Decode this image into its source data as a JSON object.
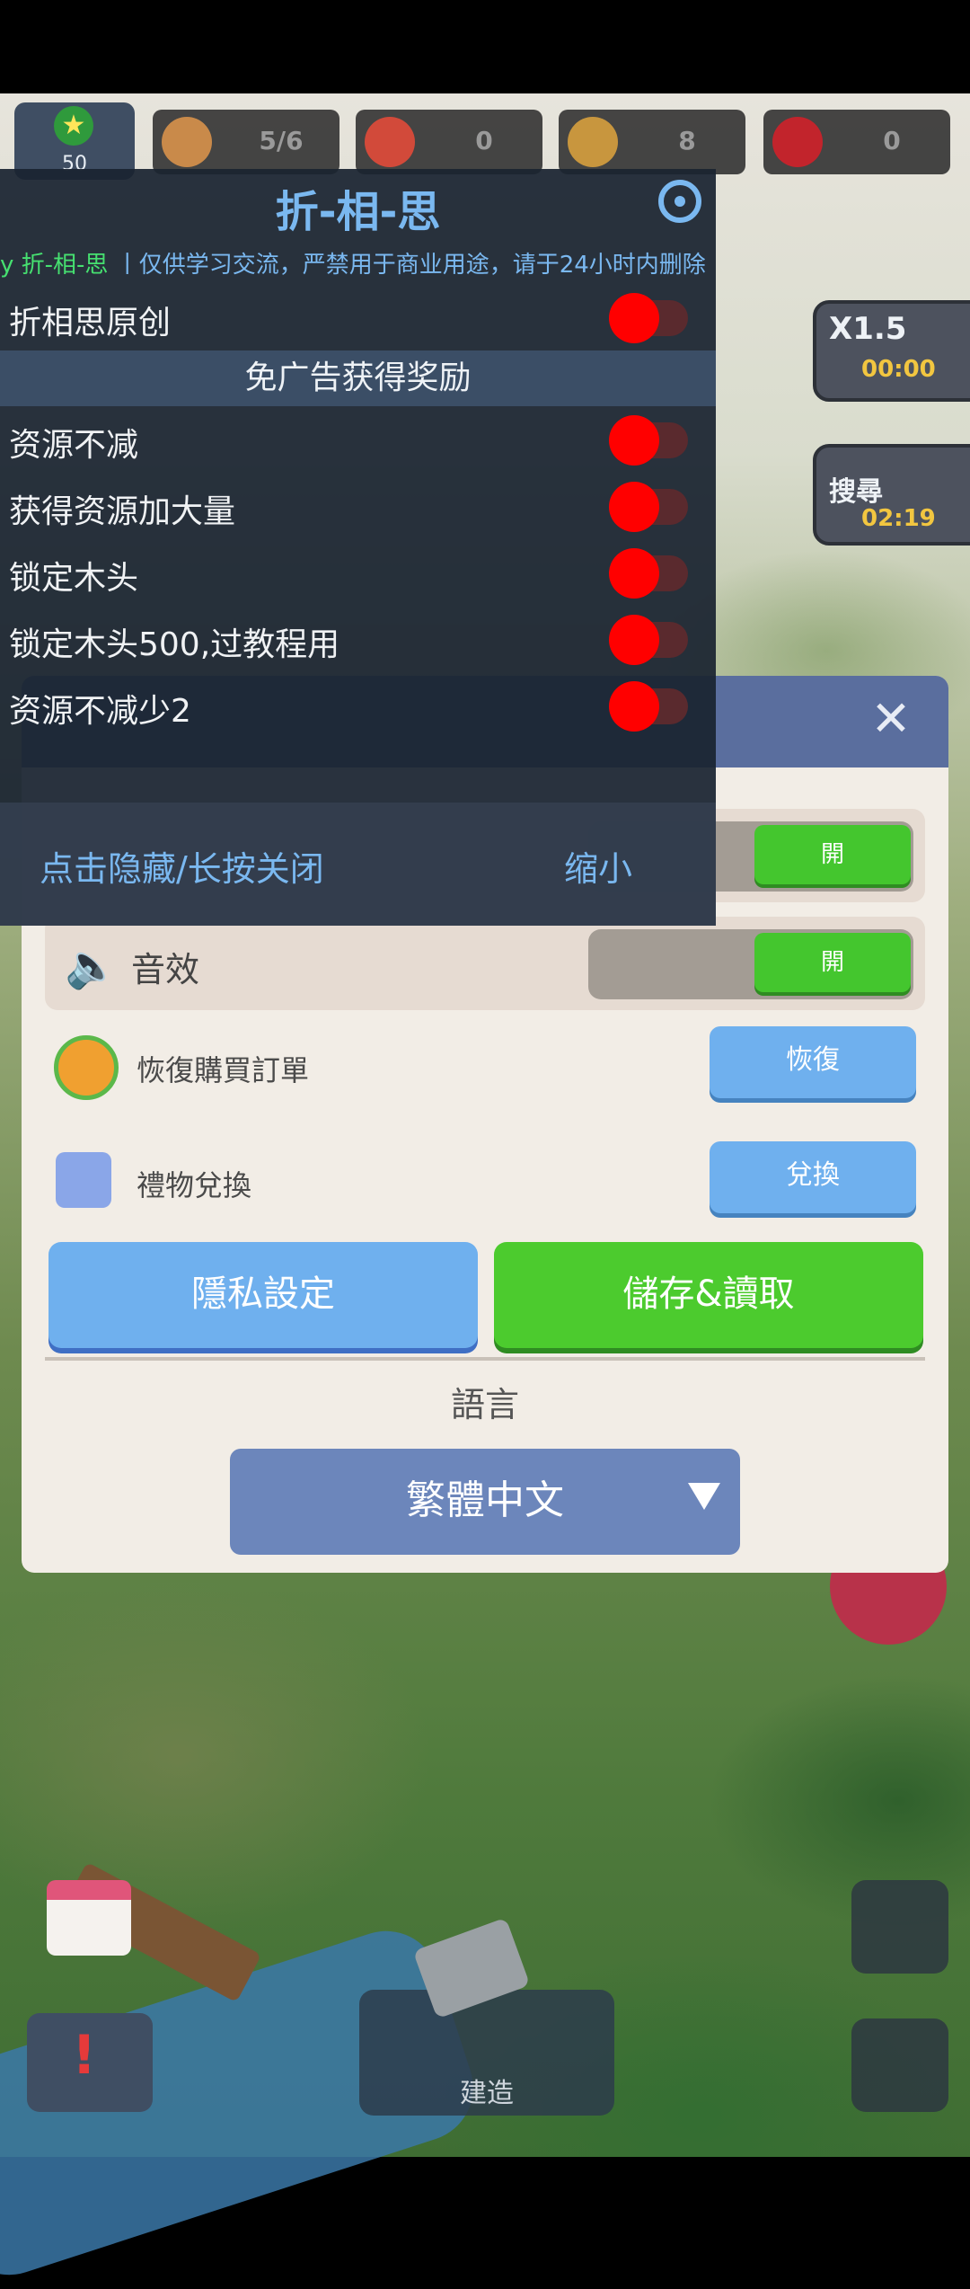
{
  "resources": {
    "player_level": "50",
    "workers": "5/6",
    "meat": "0",
    "wood": "8",
    "gems": "0"
  },
  "side_buttons": {
    "speed_label": "X1.5",
    "speed_timer": "00:00",
    "search_label": "搜尋",
    "search_timer": "02:19"
  },
  "mod_menu": {
    "title": "折-相-思",
    "ticker_name": "y 折-相-思",
    "ticker_text": "丨仅供学习交流，严禁用于商业用途，请于24小时内删除",
    "original_label": "折相思原创",
    "section_title": "免广告获得奖励",
    "items": [
      {
        "label": "资源不减"
      },
      {
        "label": "获得资源加大量"
      },
      {
        "label": "锁定木头"
      },
      {
        "label": "锁定木头500,过教程用"
      },
      {
        "label": "资源不减少2"
      }
    ],
    "hide_label": "点击隐藏/长按关闭",
    "shrink_label": "缩小"
  },
  "settings": {
    "music_toggle": "開",
    "sound_label": "音效",
    "sound_toggle": "開",
    "restore_label": "恢復購買訂單",
    "restore_button": "恢復",
    "gift_label": "禮物兌換",
    "gift_button": "兌換",
    "privacy_button": "隱私設定",
    "save_button": "儲存&讀取",
    "language_label": "語言",
    "language_value": "繁體中文"
  },
  "bottom": {
    "build_label": "建造"
  },
  "colors": {
    "green": "#44c62e",
    "blue_button": "#6fb0ee",
    "mod_accent": "#7ab8f0",
    "switch_red": "#ff0000"
  }
}
